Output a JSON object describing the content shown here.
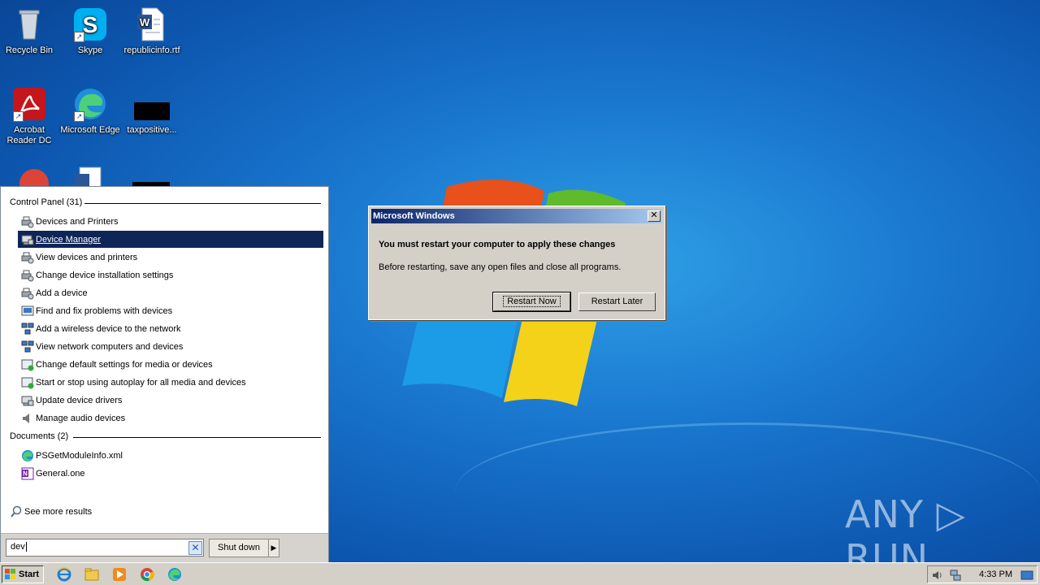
{
  "desktop": {
    "icons": [
      {
        "label": "Recycle Bin",
        "icon": "recycle-bin-icon"
      },
      {
        "label": "Skype",
        "icon": "skype-icon"
      },
      {
        "label": "republicinfo.rtf",
        "icon": "word-document-icon"
      },
      {
        "label": "Acrobat Reader DC",
        "icon": "acrobat-reader-icon"
      },
      {
        "label": "Microsoft Edge",
        "icon": "edge-icon"
      },
      {
        "label": "taxpositive...",
        "icon": "black-file-icon"
      }
    ]
  },
  "start_menu": {
    "groups": {
      "control_panel": "Control Panel (31)",
      "documents": "Documents (2)"
    },
    "control_panel_items": [
      {
        "label": "Devices and Printers",
        "icon": "devices-printers-icon"
      },
      {
        "label": "Device Manager",
        "icon": "device-manager-icon",
        "selected": true
      },
      {
        "label": "View devices and printers",
        "icon": "devices-printers-icon"
      },
      {
        "label": "Change device installation settings",
        "icon": "devices-printers-icon"
      },
      {
        "label": "Add a device",
        "icon": "devices-printers-icon"
      },
      {
        "label": "Find and fix problems with devices",
        "icon": "troubleshoot-icon"
      },
      {
        "label": "Add a wireless device to the network",
        "icon": "network-icon"
      },
      {
        "label": "View network computers and devices",
        "icon": "network-icon"
      },
      {
        "label": "Change default settings for media or devices",
        "icon": "autoplay-icon"
      },
      {
        "label": "Start or stop using autoplay for all media and devices",
        "icon": "autoplay-icon"
      },
      {
        "label": "Update device drivers",
        "icon": "device-manager-icon"
      },
      {
        "label": "Manage audio devices",
        "icon": "speaker-icon"
      }
    ],
    "document_items": [
      {
        "label": "PSGetModuleInfo.xml",
        "icon": "edge-file-icon"
      },
      {
        "label": "General.one",
        "icon": "onenote-icon"
      }
    ],
    "see_more": "See more results",
    "search_value": "dev",
    "shutdown_label": "Shut down"
  },
  "dialog": {
    "title": "Microsoft Windows",
    "close": "✕",
    "heading": "You must restart your computer to apply these changes",
    "body": "Before restarting, save any open files and close all programs.",
    "restart_now": "Restart Now",
    "restart_later": "Restart Later"
  },
  "taskbar": {
    "start_label": "Start",
    "clock": "4:33 PM"
  },
  "watermark": "ANY ▷ RUN"
}
